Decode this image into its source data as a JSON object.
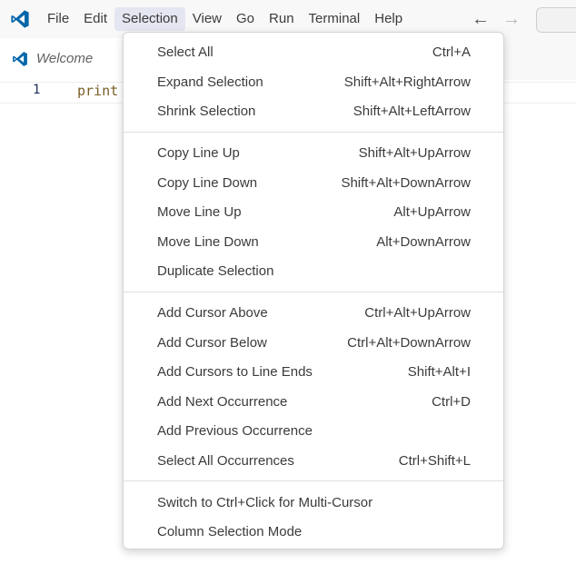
{
  "menubar": {
    "items": [
      {
        "label": "File"
      },
      {
        "label": "Edit"
      },
      {
        "label": "Selection"
      },
      {
        "label": "View"
      },
      {
        "label": "Go"
      },
      {
        "label": "Run"
      },
      {
        "label": "Terminal"
      },
      {
        "label": "Help"
      }
    ],
    "back_arrow": "←",
    "forward_arrow": "→"
  },
  "colors": {
    "accent": "#0065a9",
    "active_menu_bg": "#e4e6f1",
    "code_function": "#795e26"
  },
  "tabs": [
    {
      "label": "Welcome"
    }
  ],
  "editor": {
    "line_number": "1",
    "code": "print"
  },
  "selection_menu": {
    "groups": [
      [
        {
          "label": "Select All",
          "shortcut": "Ctrl+A"
        },
        {
          "label": "Expand Selection",
          "shortcut": "Shift+Alt+RightArrow"
        },
        {
          "label": "Shrink Selection",
          "shortcut": "Shift+Alt+LeftArrow"
        }
      ],
      [
        {
          "label": "Copy Line Up",
          "shortcut": "Shift+Alt+UpArrow"
        },
        {
          "label": "Copy Line Down",
          "shortcut": "Shift+Alt+DownArrow"
        },
        {
          "label": "Move Line Up",
          "shortcut": "Alt+UpArrow"
        },
        {
          "label": "Move Line Down",
          "shortcut": "Alt+DownArrow"
        },
        {
          "label": "Duplicate Selection",
          "shortcut": ""
        }
      ],
      [
        {
          "label": "Add Cursor Above",
          "shortcut": "Ctrl+Alt+UpArrow"
        },
        {
          "label": "Add Cursor Below",
          "shortcut": "Ctrl+Alt+DownArrow"
        },
        {
          "label": "Add Cursors to Line Ends",
          "shortcut": "Shift+Alt+I"
        },
        {
          "label": "Add Next Occurrence",
          "shortcut": "Ctrl+D"
        },
        {
          "label": "Add Previous Occurrence",
          "shortcut": ""
        },
        {
          "label": "Select All Occurrences",
          "shortcut": "Ctrl+Shift+L"
        }
      ],
      [
        {
          "label": "Switch to Ctrl+Click for Multi-Cursor",
          "shortcut": ""
        },
        {
          "label": "Column Selection Mode",
          "shortcut": ""
        }
      ]
    ]
  }
}
